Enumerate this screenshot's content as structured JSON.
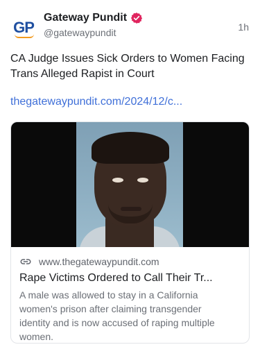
{
  "post": {
    "author": {
      "name": "Gateway Pundit",
      "handle": "@gatewaypundit",
      "avatar_text": "GP",
      "verified": true
    },
    "timestamp": "1h",
    "text": "CA Judge Issues Sick Orders to Women Facing Trans Alleged Rapist in Court",
    "link_text": "thegatewaypundit.com/2024/12/c...",
    "card": {
      "domain": "www.thegatewaypundit.com",
      "title": "Rape Victims Ordered to Call Their Tr...",
      "description": "A male was allowed to stay in a California women's prison after claiming transgender identity and is now accused of raping multiple women.",
      "image": "mugshot-photo"
    }
  },
  "colors": {
    "link": "#3f6fd8",
    "verified_badge": "#e0245e",
    "secondary_text": "#6b6f76",
    "brand_blue": "#1f4fa0",
    "brand_orange": "#f29a1f"
  },
  "icons": {
    "verified": "verified-badge-icon",
    "link": "link-icon"
  }
}
